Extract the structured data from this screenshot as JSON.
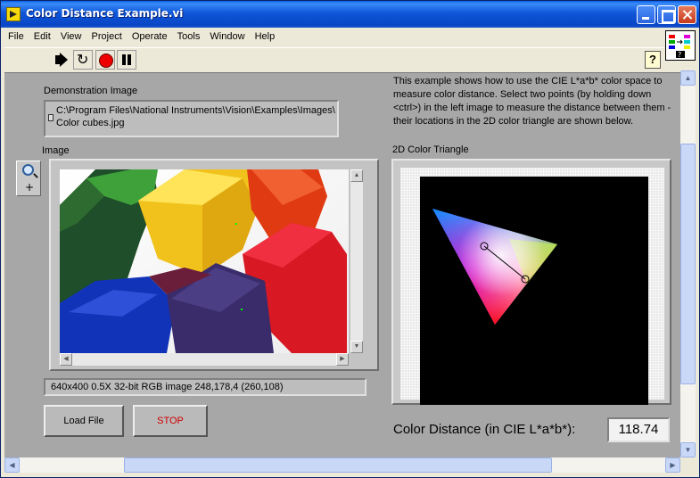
{
  "window": {
    "title": "Color Distance Example.vi"
  },
  "menu": [
    "File",
    "Edit",
    "View",
    "Project",
    "Operate",
    "Tools",
    "Window",
    "Help"
  ],
  "toolbar": {
    "run_icon": "run-arrow-icon",
    "continuous_icon": "run-continuously-icon",
    "abort_icon": "abort-icon",
    "pause_icon": "pause-icon",
    "help": "?"
  },
  "demo": {
    "label": "Demonstration Image",
    "path_line1": "C:\\Program Files\\National Instruments\\Vision\\Examples\\Images\\",
    "path_line2": "Color cubes.jpg"
  },
  "description": "This example shows how to use the CIE L*a*b* color space to measure color distance.  Select two points (by holding down <ctrl>) in the left image to measure the distance between them - their locations in the 2D color triangle are shown below.",
  "image_display": {
    "label": "Image",
    "info": "640x400 0.5X 32-bit RGB image 248,178,4    (260,108)"
  },
  "buttons": {
    "load": "Load File",
    "stop": "STOP"
  },
  "triangle": {
    "label": "2D Color Triangle"
  },
  "color_distance": {
    "label": "Color Distance (in CIE L*a*b*):",
    "value": "118.74"
  },
  "colors": {
    "stop_text": "#D00000",
    "title_bar": "#0846C6",
    "panel": "#A7A7A7"
  }
}
